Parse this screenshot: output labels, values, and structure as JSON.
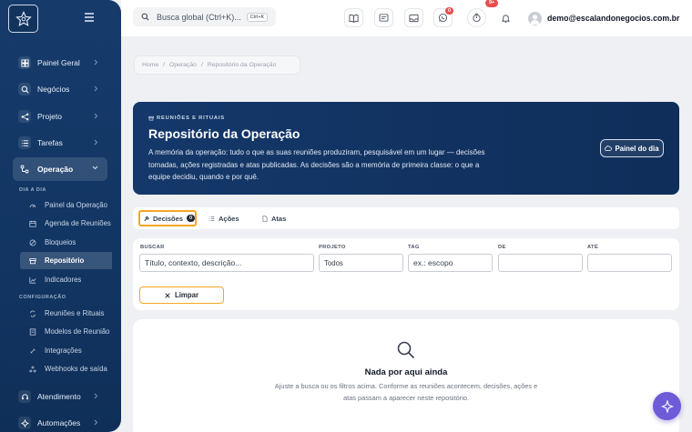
{
  "topbar": {
    "search_placeholder": "Busca global (Ctrl+K)...",
    "search_shortcut": "Ctrl+K",
    "whatsapp_badge": "0",
    "notifications_badge": "9+",
    "user_email": "demo@escalandonegocios.com.br"
  },
  "sidebar": {
    "items": [
      {
        "label": "Painel Geral",
        "icon": "dashboard-icon"
      },
      {
        "label": "Negócios",
        "icon": "search-icon"
      },
      {
        "label": "Projeto",
        "icon": "share-nodes-icon"
      },
      {
        "label": "Tarefas",
        "icon": "list-icon"
      },
      {
        "label": "Operação",
        "icon": "workflow-icon"
      },
      {
        "label": "Atendimento",
        "icon": "headset-icon"
      },
      {
        "label": "Automações",
        "icon": "bolt-icon"
      }
    ],
    "section_day": "DIA A DIA",
    "day_items": [
      {
        "label": "Painel da Operação",
        "icon": "gauge-icon"
      },
      {
        "label": "Agenda de Reuniões",
        "icon": "calendar-icon"
      },
      {
        "label": "Bloqueios",
        "icon": "block-icon"
      },
      {
        "label": "Repositório",
        "icon": "archive-icon"
      },
      {
        "label": "Indicadores",
        "icon": "chart-icon"
      }
    ],
    "section_config": "CONFIGURAÇÃO",
    "config_items": [
      {
        "label": "Reuniões e Rituais",
        "icon": "repeat-icon"
      },
      {
        "label": "Modelos de Reunião",
        "icon": "template-icon"
      },
      {
        "label": "Integrações",
        "icon": "plug-icon"
      },
      {
        "label": "Webhooks de saída",
        "icon": "webhook-icon"
      }
    ]
  },
  "breadcrumb": [
    "Home",
    "Operação",
    "Repositório da Operação"
  ],
  "breadcrumb_sep": "/",
  "hero": {
    "eyebrow": "REUNIÕES E RITUAIS",
    "title": "Repositório da Operação",
    "description": "A memória da operação: tudo o que as suas reuniões produziram, pesquisável em um lugar — decisões tomadas, ações registradas e atas publicadas. As decisões são a memória de primeira classe: o que a equipe decidiu, quando e por quê.",
    "button": "Painel do dia"
  },
  "tabs": [
    {
      "label": "Decisões",
      "count": "0"
    },
    {
      "label": "Ações"
    },
    {
      "label": "Atas"
    }
  ],
  "filters": {
    "search_label": "BUSCAR",
    "search_placeholder": "Título, contexto, descrição...",
    "project_label": "PROJETO",
    "project_value": "Todos",
    "tag_label": "TAG",
    "tag_placeholder": "ex.: escopo",
    "from_label": "DE",
    "to_label": "ATÉ",
    "clear_button": "Limpar"
  },
  "empty": {
    "title": "Nada por aqui ainda",
    "text": "Ajuste a busca ou os filtros acima. Conforme as reuniões acontecem, decisões, ações e atas passam a aparecer neste repositório."
  },
  "colors": {
    "accent": "#f5a524",
    "sidebar": "#163b6b",
    "hero": "#14386a",
    "fab": "#6d5bd8",
    "badge": "#e94e4e"
  }
}
